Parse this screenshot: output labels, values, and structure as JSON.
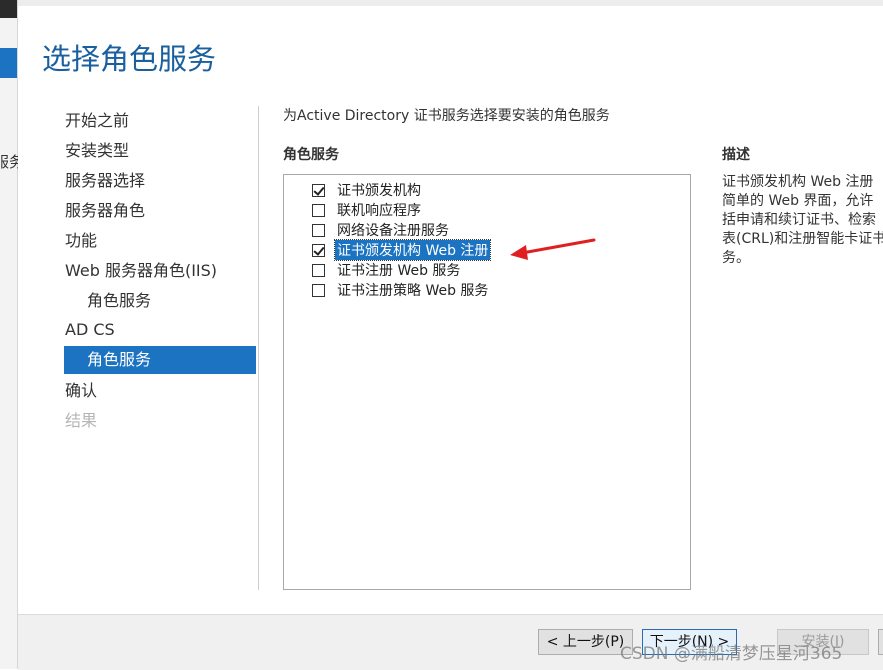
{
  "background": {
    "clipped_text": "服务"
  },
  "page": {
    "title": "选择角色服务"
  },
  "nav": {
    "items": [
      {
        "label": "开始之前"
      },
      {
        "label": "安装类型"
      },
      {
        "label": "服务器选择"
      },
      {
        "label": "服务器角色"
      },
      {
        "label": "功能"
      },
      {
        "label": "Web 服务器角色(IIS)"
      },
      {
        "label": "角色服务"
      },
      {
        "label": "AD CS"
      },
      {
        "label": "角色服务"
      },
      {
        "label": "确认"
      },
      {
        "label": "结果"
      }
    ]
  },
  "main": {
    "intro": "为Active Directory 证书服务选择要安装的角色服务",
    "roles_heading": "角色服务",
    "roles": [
      {
        "label": "证书颁发机构",
        "checked": true
      },
      {
        "label": "联机响应程序",
        "checked": false
      },
      {
        "label": "网络设备注册服务",
        "checked": false
      },
      {
        "label": "证书颁发机构 Web 注册",
        "checked": true,
        "selected": true
      },
      {
        "label": "证书注册 Web 服务",
        "checked": false
      },
      {
        "label": "证书注册策略 Web 服务",
        "checked": false
      }
    ]
  },
  "description": {
    "heading": "描述",
    "lines": [
      "证书颁发机构 Web 注册",
      "简单的 Web 界面，允许",
      "括申请和续订证书、检索",
      "表(CRL)和注册智能卡证书",
      "务。"
    ]
  },
  "footer": {
    "prev_label": "< 上一步(P)",
    "next_label": "下一步(N) >",
    "install_label": "安装(I)"
  },
  "watermark": "CSDN @满船清梦压星河365",
  "colors": {
    "accent": "#1c73c1",
    "title": "#1a5f9e",
    "annotation_arrow": "#e02020"
  },
  "icons": {
    "annotation": "red-arrow-icon",
    "checkbox": "checkmark-icon"
  }
}
